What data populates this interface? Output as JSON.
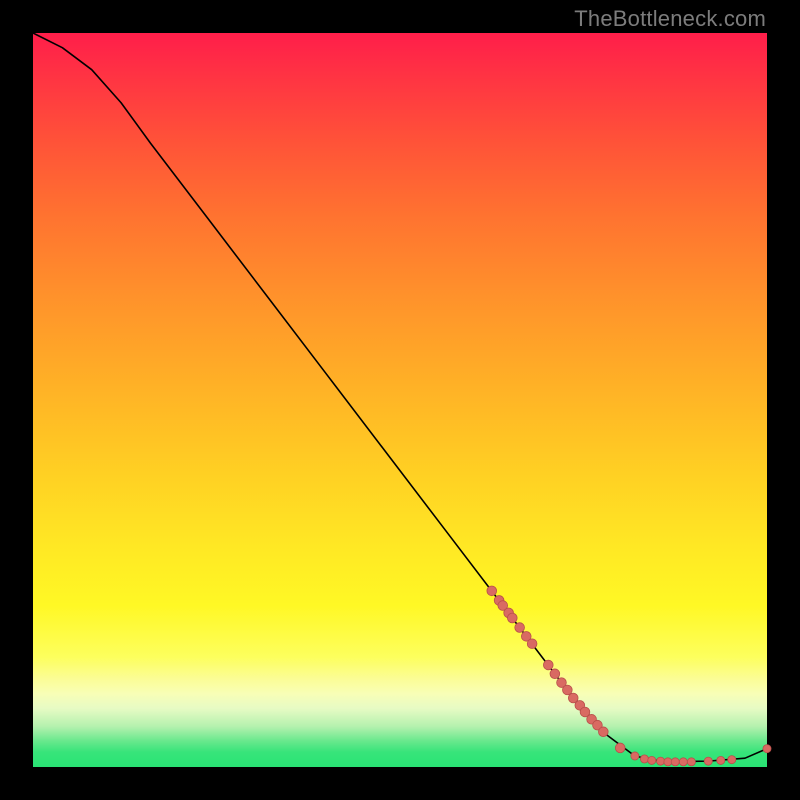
{
  "watermark": "TheBottleneck.com",
  "colors": {
    "marker_fill": "#d96a62",
    "marker_stroke": "#b84f4a",
    "curve": "#000000"
  },
  "chart_data": {
    "type": "line",
    "title": "",
    "xlabel": "",
    "ylabel": "",
    "xlim": [
      0,
      100
    ],
    "ylim": [
      0,
      100
    ],
    "grid": false,
    "legend": false,
    "curve": [
      {
        "x": 0,
        "y": 100
      },
      {
        "x": 4,
        "y": 98
      },
      {
        "x": 8,
        "y": 95
      },
      {
        "x": 12,
        "y": 90.5
      },
      {
        "x": 16,
        "y": 85
      },
      {
        "x": 24,
        "y": 74.5
      },
      {
        "x": 32,
        "y": 64
      },
      {
        "x": 40,
        "y": 53.5
      },
      {
        "x": 48,
        "y": 43
      },
      {
        "x": 56,
        "y": 32.5
      },
      {
        "x": 64,
        "y": 22
      },
      {
        "x": 72,
        "y": 11.5
      },
      {
        "x": 78,
        "y": 4.5
      },
      {
        "x": 82,
        "y": 1.5
      },
      {
        "x": 86,
        "y": 0.7
      },
      {
        "x": 92,
        "y": 0.8
      },
      {
        "x": 97,
        "y": 1.2
      },
      {
        "x": 100,
        "y": 2.5
      }
    ],
    "markers": [
      {
        "x": 62.5,
        "y": 24.0,
        "r": 1.2
      },
      {
        "x": 63.5,
        "y": 22.7,
        "r": 1.2
      },
      {
        "x": 64.0,
        "y": 22.0,
        "r": 1.2
      },
      {
        "x": 64.8,
        "y": 21.0,
        "r": 1.2
      },
      {
        "x": 65.3,
        "y": 20.3,
        "r": 1.2
      },
      {
        "x": 66.3,
        "y": 19.0,
        "r": 1.2
      },
      {
        "x": 67.2,
        "y": 17.8,
        "r": 1.2
      },
      {
        "x": 68.0,
        "y": 16.8,
        "r": 1.2
      },
      {
        "x": 70.2,
        "y": 13.9,
        "r": 1.2
      },
      {
        "x": 71.1,
        "y": 12.7,
        "r": 1.2
      },
      {
        "x": 72.0,
        "y": 11.5,
        "r": 1.2
      },
      {
        "x": 72.8,
        "y": 10.5,
        "r": 1.2
      },
      {
        "x": 73.6,
        "y": 9.4,
        "r": 1.2
      },
      {
        "x": 74.5,
        "y": 8.4,
        "r": 1.2
      },
      {
        "x": 75.2,
        "y": 7.5,
        "r": 1.2
      },
      {
        "x": 76.1,
        "y": 6.5,
        "r": 1.2
      },
      {
        "x": 76.9,
        "y": 5.7,
        "r": 1.2
      },
      {
        "x": 77.7,
        "y": 4.8,
        "r": 1.2
      },
      {
        "x": 80.0,
        "y": 2.6,
        "r": 1.2
      },
      {
        "x": 82.0,
        "y": 1.5,
        "r": 1.0
      },
      {
        "x": 83.3,
        "y": 1.1,
        "r": 1.0
      },
      {
        "x": 84.3,
        "y": 0.9,
        "r": 1.0
      },
      {
        "x": 85.5,
        "y": 0.8,
        "r": 1.0
      },
      {
        "x": 86.5,
        "y": 0.7,
        "r": 1.0
      },
      {
        "x": 87.5,
        "y": 0.7,
        "r": 1.0
      },
      {
        "x": 88.6,
        "y": 0.7,
        "r": 1.0
      },
      {
        "x": 89.7,
        "y": 0.7,
        "r": 1.0
      },
      {
        "x": 92.0,
        "y": 0.8,
        "r": 1.0
      },
      {
        "x": 93.7,
        "y": 0.9,
        "r": 1.0
      },
      {
        "x": 95.2,
        "y": 1.0,
        "r": 1.0
      },
      {
        "x": 100.0,
        "y": 2.5,
        "r": 1.0
      }
    ]
  }
}
